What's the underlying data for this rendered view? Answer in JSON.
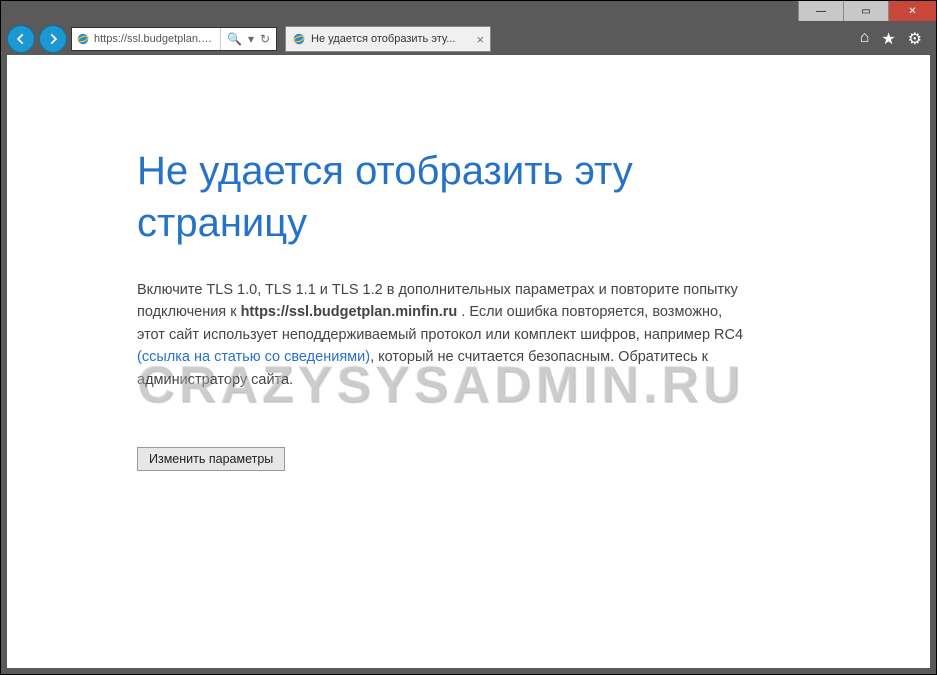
{
  "window": {
    "minimize": "—",
    "maximize": "▭",
    "close": "✕"
  },
  "toolbar": {
    "url": "https://ssl.budgetplan.m...",
    "search_glyph": "🔍",
    "refresh_glyph": "↻",
    "dropdown_glyph": "▾"
  },
  "tab": {
    "title": "Не удается отобразить эту...",
    "close": "×"
  },
  "right_icons": {
    "home": "⌂",
    "star": "★",
    "gear": "⚙"
  },
  "page": {
    "title": "Не удается отобразить эту страницу",
    "body_prefix": "Включите TLS 1.0, TLS 1.1 и TLS 1.2 в дополнительных параметрах и повторите попытку подключения к ",
    "body_host": "https://ssl.budgetplan.minfin.ru",
    "body_mid": " . Если ошибка повторяется, возможно, этот сайт использует неподдерживаемый протокол или комплект шифров, например RC4 ",
    "body_link": "(ссылка на статью со сведениями)",
    "body_suffix": ", который не считается безопасным. Обратитесь к администратору сайта.",
    "button": "Изменить параметры"
  },
  "watermark": "CRAZYSYSADMIN.RU"
}
